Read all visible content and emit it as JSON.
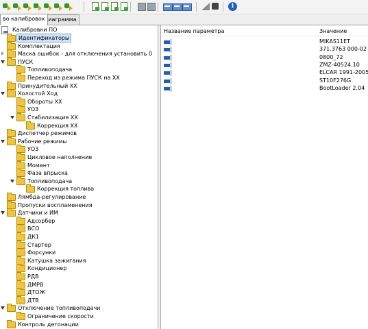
{
  "toolbar": {
    "buttons": [
      "import-icon",
      "import-icon",
      "import-icon",
      "import-icon",
      "import-icon",
      "import-icon",
      "import-icon",
      "sheet-icon",
      "sheet-icon",
      "sheet-icon",
      "sheet-icon",
      "grey-icon",
      "grey-icon",
      "table-icon",
      "table-icon",
      "table-icon",
      "ramp-icon",
      "book-icon",
      "info-icon"
    ]
  },
  "tabs": [
    {
      "label": "во калибровок",
      "active": true
    },
    {
      "label": "Диаграмма",
      "active": false
    }
  ],
  "tree": {
    "root": "Калибровки ПО",
    "items": [
      {
        "label": "Идентификаторы",
        "level": 0,
        "exp": "none",
        "selected": true
      },
      {
        "label": "Комплектация",
        "level": 0,
        "exp": "none"
      },
      {
        "label": "Маска ошибок - для отключения установить 0",
        "level": 0,
        "exp": "closed"
      },
      {
        "label": "ПУСК",
        "level": 0,
        "exp": "open"
      },
      {
        "label": "Топливоподача",
        "level": 1,
        "exp": "none"
      },
      {
        "label": "Переход из режима ПУСК на ХХ",
        "level": 1,
        "exp": "none"
      },
      {
        "label": "Принудительный ХХ",
        "level": 0,
        "exp": "none"
      },
      {
        "label": "Холостой Ход",
        "level": 0,
        "exp": "open"
      },
      {
        "label": "Обороты ХХ",
        "level": 1,
        "exp": "none"
      },
      {
        "label": "УОЗ",
        "level": 1,
        "exp": "none"
      },
      {
        "label": "Стабилизация ХХ",
        "level": 1,
        "exp": "open"
      },
      {
        "label": "Коррекция ХХ",
        "level": 2,
        "exp": "none"
      },
      {
        "label": "Диспетчер режимов",
        "level": 0,
        "exp": "none"
      },
      {
        "label": "Рабочие режимы",
        "level": 0,
        "exp": "open"
      },
      {
        "label": "УОЗ",
        "level": 1,
        "exp": "none"
      },
      {
        "label": "Цикловое наполнение",
        "level": 1,
        "exp": "none"
      },
      {
        "label": "Момент",
        "level": 1,
        "exp": "none"
      },
      {
        "label": "Фаза впрыска",
        "level": 1,
        "exp": "none"
      },
      {
        "label": "Топливоподача",
        "level": 1,
        "exp": "open"
      },
      {
        "label": "Коррекция топлива",
        "level": 2,
        "exp": "none"
      },
      {
        "label": "Лямбда-регулирование",
        "level": 0,
        "exp": "none"
      },
      {
        "label": "Пропуски воспламенения",
        "level": 0,
        "exp": "none"
      },
      {
        "label": "Датчики и ИМ",
        "level": 0,
        "exp": "open"
      },
      {
        "label": "Адсорбер",
        "level": 1,
        "exp": "none"
      },
      {
        "label": "ВСО",
        "level": 1,
        "exp": "none"
      },
      {
        "label": "ДК1",
        "level": 1,
        "exp": "none"
      },
      {
        "label": "Стартер",
        "level": 1,
        "exp": "none"
      },
      {
        "label": "Форсунки",
        "level": 1,
        "exp": "none"
      },
      {
        "label": "Катушка зажигания",
        "level": 1,
        "exp": "none"
      },
      {
        "label": "Кондиционер",
        "level": 1,
        "exp": "none"
      },
      {
        "label": "РДВ",
        "level": 1,
        "exp": "none"
      },
      {
        "label": "ДМРВ",
        "level": 1,
        "exp": "none"
      },
      {
        "label": "ДТОЖ",
        "level": 1,
        "exp": "none"
      },
      {
        "label": "ДТВ",
        "level": 1,
        "exp": "none"
      },
      {
        "label": "Отключение топливоподачи",
        "level": 0,
        "exp": "open"
      },
      {
        "label": "Ограничение скорости",
        "level": 1,
        "exp": "none"
      },
      {
        "label": "Контроль детонации",
        "level": 0,
        "exp": "none"
      }
    ]
  },
  "params": {
    "col_name": "Название параметра",
    "col_value": "Значение",
    "rows": [
      {
        "name": "",
        "value": "MIKAS11ET"
      },
      {
        "name": "",
        "value": "371.3763 000-02"
      },
      {
        "name": "",
        "value": "0800_72"
      },
      {
        "name": "",
        "value": "ZMZ-40524.10"
      },
      {
        "name": "",
        "value": "ELCAR 1991-2005"
      },
      {
        "name": "",
        "value": "ST10F276G"
      },
      {
        "name": "",
        "value": "BootLoader 2.04"
      }
    ]
  }
}
